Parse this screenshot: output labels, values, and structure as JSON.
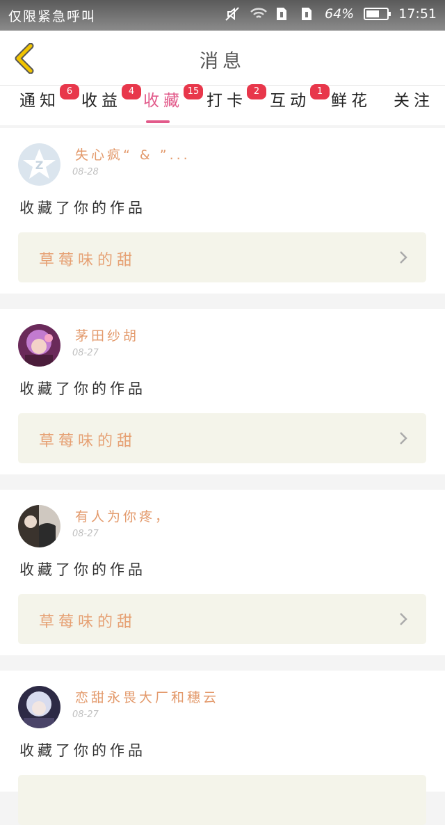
{
  "status_bar": {
    "carrier": "仅限紧急呼叫",
    "battery_pct": "64%",
    "battery_level": 0.64,
    "time": "17:51",
    "icons": [
      "mute-icon",
      "wifi-icon",
      "sim-icon",
      "sim-icon",
      "battery-icon"
    ]
  },
  "header": {
    "title": "消息"
  },
  "tabs": [
    {
      "label": "通知",
      "badge": "6"
    },
    {
      "label": "收益",
      "badge": "4"
    },
    {
      "label": "收藏",
      "badge": "15",
      "active": true
    },
    {
      "label": "打卡",
      "badge": "2"
    },
    {
      "label": "互动",
      "badge": "1"
    },
    {
      "label": "鲜花",
      "badge": ""
    },
    {
      "label": "关注",
      "badge": ""
    }
  ],
  "notifications": [
    {
      "user": "失心疯“ & ”...",
      "date": "08-28",
      "action": "收藏了你的作品",
      "work_title": "草莓味的甜"
    },
    {
      "user": "茅田纱胡",
      "date": "08-27",
      "action": "收藏了你的作品",
      "work_title": "草莓味的甜"
    },
    {
      "user": "有人为你疼，",
      "date": "08-27",
      "action": "收藏了你的作品",
      "work_title": "草莓味的甜"
    },
    {
      "user": "恋甜永畏大厂和穗云",
      "date": "08-27",
      "action": "收藏了你的作品",
      "work_title": ""
    }
  ],
  "colors": {
    "accent": "#e25a8a",
    "badge": "#e8374b",
    "username": "#e39a6c",
    "work_box": "#f4f4ea",
    "back_arrow": "#f1c400"
  }
}
